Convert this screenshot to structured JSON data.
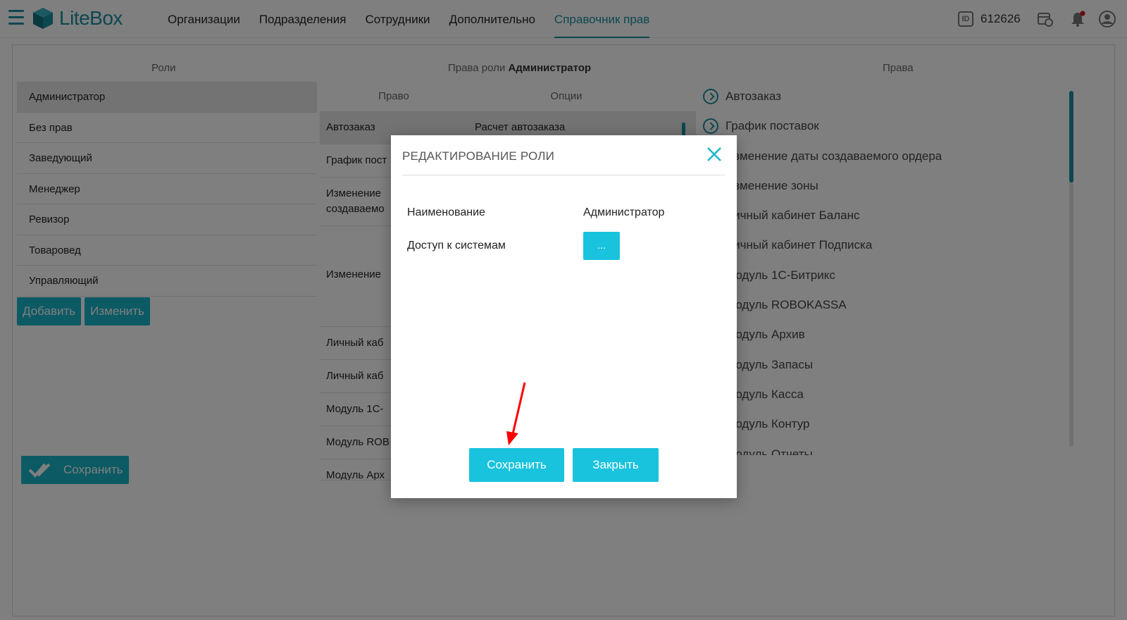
{
  "app": {
    "logo_text": "LiteBox",
    "nav": [
      "Организации",
      "Подразделения",
      "Сотрудники",
      "Дополнительно",
      "Справочник прав"
    ],
    "active_nav": "Справочник прав",
    "user_id_badge": "ID",
    "user_id": "612626"
  },
  "columns": {
    "roles_header": "Роли",
    "role_rights_header_prefix": "Права роли",
    "role_rights_header_name": "Администратор",
    "rights_header": "Права"
  },
  "roles": [
    "Администратор",
    "Без прав",
    "Заведующий",
    "Менеджер",
    "Ревизор",
    "Товаровед",
    "Управляющий"
  ],
  "role_buttons": {
    "add": "Добавить",
    "edit": "Изменить"
  },
  "save_button": "Сохранить",
  "rights_table": {
    "col_right": "Право",
    "col_options": "Опции",
    "rows": [
      {
        "right": "Автозаказ",
        "option": "Расчет автозаказа"
      },
      {
        "right": "График пост",
        "option": ""
      },
      {
        "right": "Изменение создаваемо",
        "option": ""
      },
      {
        "right": "Изменение",
        "option": ""
      },
      {
        "right": "Личный каб",
        "option": ""
      },
      {
        "right": "Личный каб",
        "option": ""
      },
      {
        "right": "Модуль 1С-",
        "option": ""
      },
      {
        "right": "Модуль ROB",
        "option": ""
      },
      {
        "right": "Модуль Арх",
        "option": ""
      }
    ]
  },
  "rights_list": [
    "Автозаказ",
    "График поставок",
    "Изменение даты создаваемого ордера",
    "Изменение зоны",
    "Личный кабинет Баланс",
    "Личный кабинет Подписка",
    "Модуль 1С-Битрикс",
    "Модуль ROBOKASSA",
    "Модуль Архив",
    "Модуль Запасы",
    "Модуль Касса",
    "Модуль Контур",
    "Модуль Отчеты"
  ],
  "modal": {
    "title": "РЕДАКТИРОВАНИЕ РОЛИ",
    "name_label": "Наименование",
    "name_value": "Администратор",
    "access_label": "Доступ к системам",
    "access_button": "...",
    "save": "Сохранить",
    "close": "Закрыть"
  },
  "colors": {
    "accent": "#19c3de",
    "brand": "#1a8fa0",
    "annotation_arrow": "#ff0000"
  }
}
